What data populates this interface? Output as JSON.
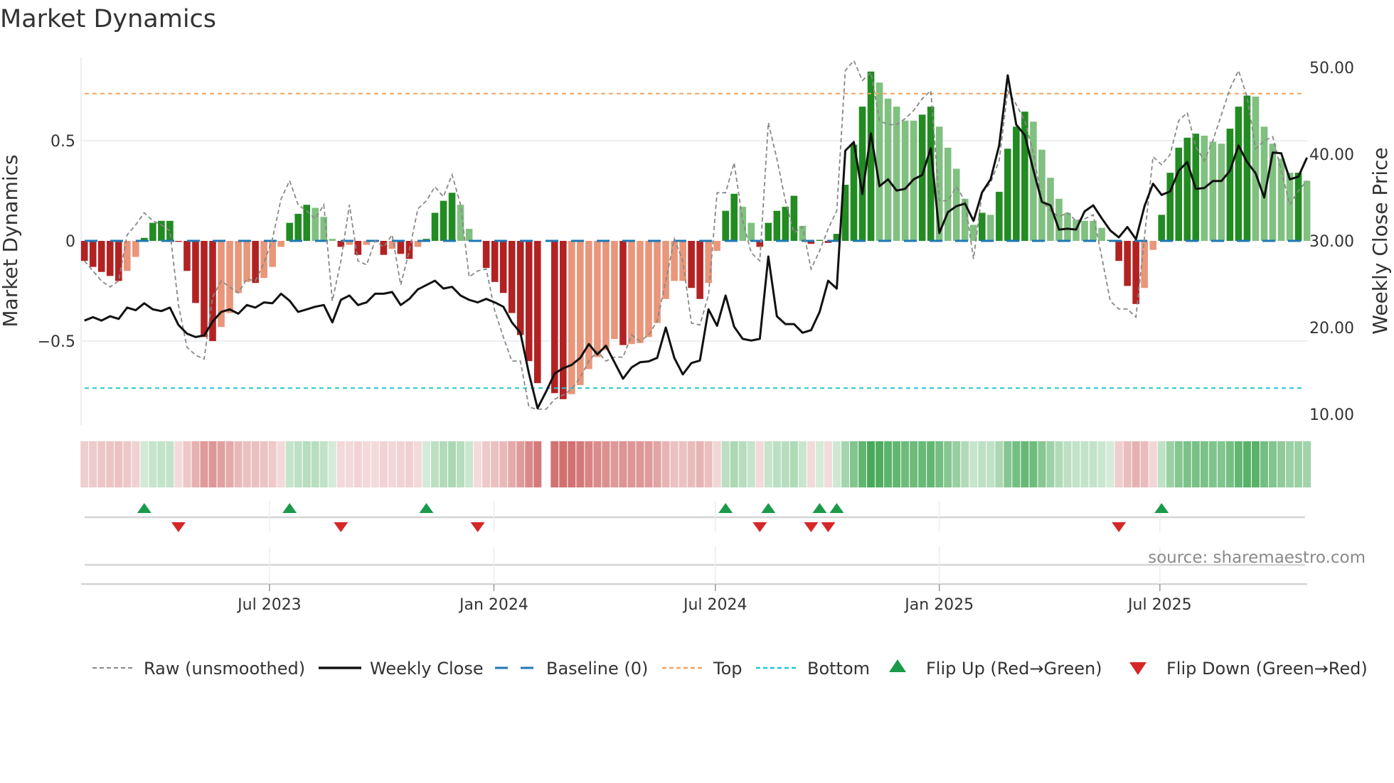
{
  "chart_data": {
    "type": "bar",
    "title": "Market Dynamics",
    "ylabel": "Market Dynamics",
    "y2label": "Weekly Close Price",
    "ylim": [
      -0.92,
      0.95
    ],
    "y2lim": [
      7.5,
      52.5
    ],
    "yticks": [
      {
        "value": 0.5,
        "label": "0.5"
      },
      {
        "value": 0,
        "label": "0"
      },
      {
        "value": -0.5,
        "label": "−0.5"
      }
    ],
    "y2ticks": [
      {
        "value": 50,
        "label": "50.00"
      },
      {
        "value": 40,
        "label": "40.00"
      },
      {
        "value": 30,
        "label": "30.00"
      },
      {
        "value": 20,
        "label": "20.00"
      },
      {
        "value": 10,
        "label": "10.00"
      }
    ],
    "xticks": [
      {
        "label": "Jul 2023",
        "week_index": 21.65
      },
      {
        "label": "Jan 2024",
        "week_index": 47.9
      },
      {
        "label": "Jul 2024",
        "week_index": 73.8
      },
      {
        "label": "Jan 2025",
        "week_index": 100.0
      },
      {
        "label": "Jul 2025",
        "week_index": 125.8
      }
    ],
    "top_level": 0.735,
    "bottom_level": -0.735,
    "baseline": 0,
    "grid": true,
    "legend_position": "bottom",
    "colors": {
      "up_strong": "#228b22",
      "up_weak": "#80c080",
      "down_strong": "#b22222",
      "down_weak": "#e9967a",
      "raw": "#888888",
      "close": "#111111",
      "baseline": "#1f77b4",
      "top": "#f4a460",
      "bottom": "#22c7d6",
      "flip_up": "#1a9a4a",
      "flip_down": "#d62728"
    },
    "smoothed": [
      -0.1,
      -0.13,
      -0.155,
      -0.175,
      -0.2,
      -0.15,
      -0.08,
      0.015,
      0.09,
      0.1,
      0.1,
      -0.005,
      -0.15,
      -0.31,
      -0.48,
      -0.5,
      -0.43,
      -0.36,
      -0.26,
      -0.205,
      -0.21,
      -0.185,
      -0.13,
      -0.03,
      0.09,
      0.135,
      0.18,
      0.165,
      0.12,
      0.01,
      -0.03,
      -0.02,
      -0.07,
      -0.02,
      -0.005,
      -0.07,
      -0.04,
      -0.065,
      -0.09,
      -0.03,
      0.01,
      0.14,
      0.2,
      0.24,
      0.18,
      0.06,
      -0.005,
      -0.135,
      -0.205,
      -0.26,
      -0.36,
      -0.47,
      -0.6,
      -0.71,
      null,
      -0.76,
      -0.79,
      -0.765,
      -0.72,
      -0.64,
      -0.58,
      -0.545,
      -0.49,
      -0.52,
      -0.515,
      -0.51,
      -0.48,
      -0.41,
      -0.29,
      -0.2,
      -0.2,
      -0.235,
      -0.29,
      -0.21,
      -0.05,
      0.15,
      0.235,
      0.17,
      0.09,
      -0.03,
      0.09,
      0.15,
      0.17,
      0.225,
      0.075,
      -0.015,
      0.005,
      -0.01,
      0.035,
      0.28,
      0.48,
      0.67,
      0.845,
      0.79,
      0.71,
      0.67,
      0.6,
      0.6,
      0.63,
      0.67,
      0.57,
      0.465,
      0.36,
      0.21,
      0.08,
      0.14,
      0.13,
      0.245,
      0.46,
      0.57,
      0.645,
      0.595,
      0.455,
      0.315,
      0.21,
      0.14,
      0.105,
      0.1,
      0.1,
      0.065,
      0.005,
      -0.1,
      -0.225,
      -0.315,
      -0.235,
      -0.045,
      0.13,
      0.34,
      0.465,
      0.515,
      0.535,
      0.525,
      0.495,
      0.485,
      0.56,
      0.67,
      0.725,
      0.72,
      0.57,
      0.485,
      0.41,
      0.34,
      0.34,
      0.3
    ],
    "shade": "DDDDDLLDDDDDDDDDLLLLDLLLDDDLLLDLDLDDLDDLDDDDLLDDDDDDDDDDDLLLLLLDLLLLLLLDDLLDDLLDDDDDLDDDDDDDDLLLLLDDLLLLLDLDDDDLLLLLLLLLDDDDLLDDDDDLLLDDDLLLLLDL",
    "raw": [
      -0.1,
      -0.15,
      -0.2,
      -0.23,
      -0.2,
      0.03,
      0.08,
      0.14,
      0.1,
      0.08,
      0.05,
      -0.32,
      -0.53,
      -0.57,
      -0.59,
      -0.28,
      -0.2,
      -0.23,
      -0.26,
      -0.19,
      -0.2,
      -0.11,
      0.01,
      0.21,
      0.3,
      0.18,
      0.15,
      0.11,
      0.18,
      -0.3,
      -0.1,
      0.18,
      -0.1,
      -0.12,
      0.0,
      -0.03,
      0.03,
      -0.22,
      -0.05,
      0.16,
      0.2,
      0.27,
      0.22,
      0.33,
      0.18,
      -0.18,
      -0.15,
      -0.14,
      -0.35,
      -0.48,
      -0.6,
      -0.6,
      -0.83,
      -0.84,
      -0.84,
      -0.79,
      -0.77,
      -0.74,
      -0.68,
      -0.6,
      -0.55,
      -0.6,
      -0.58,
      -0.58,
      -0.47,
      -0.5,
      -0.47,
      -0.4,
      -0.2,
      0.01,
      -0.1,
      -0.41,
      -0.42,
      -0.27,
      0.24,
      0.24,
      0.39,
      0.1,
      -0.06,
      -0.1,
      0.59,
      0.41,
      0.2,
      0.04,
      0.07,
      -0.14,
      -0.05,
      0.06,
      0.15,
      0.85,
      0.9,
      0.8,
      0.84,
      0.6,
      0.58,
      0.58,
      0.61,
      0.65,
      0.71,
      0.75,
      0.2,
      0.2,
      0.27,
      0.2,
      -0.09,
      0.24,
      0.29,
      0.4,
      0.75,
      0.68,
      0.6,
      0.44,
      0.2,
      0.15,
      0.12,
      0.14,
      0.1,
      0.11,
      0.13,
      -0.08,
      -0.3,
      -0.34,
      -0.34,
      -0.38,
      0.02,
      0.42,
      0.38,
      0.43,
      0.6,
      0.64,
      0.47,
      0.4,
      0.5,
      0.63,
      0.76,
      0.85,
      0.72,
      0.46,
      0.5,
      0.52,
      0.35,
      0.18,
      0.25,
      0.3
    ],
    "weekly_close": [
      20.8,
      21.2,
      20.8,
      21.3,
      21.0,
      22.3,
      22.0,
      22.8,
      22.1,
      21.9,
      22.3,
      20.3,
      19.3,
      18.9,
      19.1,
      20.7,
      21.8,
      22.1,
      21.6,
      22.6,
      22.3,
      22.9,
      22.8,
      23.9,
      23.1,
      21.8,
      22.1,
      22.4,
      22.6,
      20.6,
      23.2,
      23.7,
      22.6,
      22.9,
      23.9,
      23.9,
      24.1,
      22.6,
      23.3,
      24.4,
      24.9,
      25.4,
      24.5,
      24.7,
      23.7,
      23.2,
      22.9,
      23.3,
      22.9,
      22.4,
      20.6,
      19.4,
      14.7,
      10.7,
      12.6,
      14.7,
      15.3,
      15.7,
      16.5,
      18.1,
      16.9,
      17.9,
      16.0,
      14.1,
      15.4,
      16.0,
      16.1,
      16.5,
      20.0,
      16.5,
      14.6,
      15.9,
      16.2,
      22.1,
      20.2,
      23.7,
      20.1,
      18.7,
      18.5,
      18.7,
      28.2,
      21.3,
      20.4,
      20.4,
      19.4,
      19.7,
      21.8,
      25.4,
      24.5,
      40.4,
      41.4,
      35.4,
      42.4,
      36.3,
      37.1,
      35.8,
      36.0,
      37.1,
      37.6,
      40.7,
      30.9,
      33.3,
      34.0,
      34.3,
      32.3,
      35.6,
      37.1,
      41.0,
      49.1,
      43.4,
      42.2,
      38.2,
      34.5,
      34.1,
      31.3,
      31.4,
      31.3,
      33.4,
      34.1,
      32.6,
      31.2,
      30.4,
      31.6,
      30.2,
      34.0,
      36.6,
      35.3,
      35.7,
      38.1,
      39.1,
      36.0,
      36.1,
      36.9,
      36.9,
      38.1,
      41.0,
      39.1,
      37.8,
      35.0,
      40.2,
      40.1,
      37.1,
      37.4,
      39.6
    ],
    "flip_up_weeks": [
      7,
      24,
      40,
      75,
      80,
      86,
      88,
      126
    ],
    "flip_down_weeks": [
      11,
      30,
      46,
      79,
      85,
      87,
      121
    ],
    "legend": [
      {
        "key": "raw",
        "label": "Raw (unsmoothed)"
      },
      {
        "key": "close",
        "label": "Weekly Close"
      },
      {
        "key": "baseline",
        "label": "Baseline (0)"
      },
      {
        "key": "top",
        "label": "Top"
      },
      {
        "key": "bottom",
        "label": "Bottom"
      },
      {
        "key": "flip_up",
        "label": "Flip Up (Red→Green)"
      },
      {
        "key": "flip_down",
        "label": "Flip Down (Green→Red)"
      }
    ],
    "source": "source: sharemaestro.com"
  }
}
